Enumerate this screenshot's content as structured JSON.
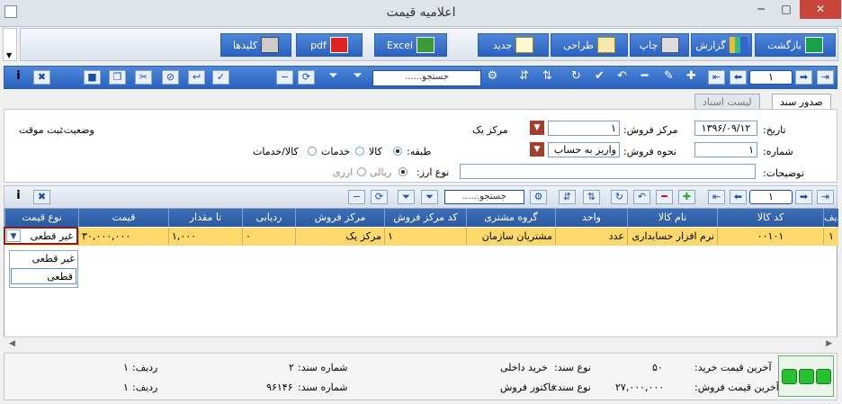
{
  "window": {
    "title": "اعلامیه قیمت"
  },
  "toolbar": {
    "back": "بازگشت",
    "report": "گزارش",
    "print": "چاپ",
    "design": "طراحی",
    "new": "جدید",
    "excel": "Excel",
    "pdf": "pdf",
    "keys": "کلیدها"
  },
  "nav1": {
    "record": "۱",
    "search": "......جستجو"
  },
  "nav2": {
    "record": "۱",
    "search": "......جستجو"
  },
  "tabs": [
    "صدور سند",
    "لیست اسناد"
  ],
  "form": {
    "date_label": "تاریخ:",
    "date_value": "۱۳۹۶/۰۹/۱۲",
    "number_label": "شماره:",
    "number_value": "۱",
    "desc_label": "توضیحات:",
    "center_label": "مرکز فروش:",
    "center_value": "۱",
    "center_name": "مرکز یک",
    "method_label": "نحوه فروش:",
    "method_value": "واریز به حساب",
    "status_label": "وضعیت:",
    "status_value": "ثبت موقت",
    "class_label": "طبقه:",
    "class_opt1": "کالا",
    "class_opt2": "خدمات",
    "class_opt3": "کالا/خدمات",
    "currency_label": "نوع ارز:",
    "currency_opt1": "ریالی",
    "currency_opt2": "ارزی"
  },
  "grid": {
    "headers": [
      "ردیف",
      "کد کالا",
      "نام کالا",
      "واحد",
      "گروه مشتری",
      "کد مرکز فروش",
      "مرکز فروش",
      "ردیابی",
      "تا مقدار",
      "قیمت",
      "نوع قیمت"
    ],
    "row": [
      "۱",
      "۰۰۱۰۱",
      "نرم افزار حسابداری",
      "عدد",
      "مشتریان سازمان",
      "۱",
      "مرکز یک",
      "۰",
      "۱,۰۰۰",
      "۳۰,۰۰۰,۰۰۰",
      "غیر قطعی"
    ]
  },
  "dropdown": {
    "options": [
      "غیر قطعی",
      "قطعی"
    ]
  },
  "footer": {
    "last_buy_label": "آخرین قیمت خرید:",
    "last_buy_value": "۵۰",
    "last_sell_label": "آخرین قیمت فروش:",
    "last_sell_value": "۲۷,۰۰۰,۰۰۰",
    "doc_type_label": "نوع سند:",
    "doc_type1": "خرید داخلی",
    "doc_type2": "فاکتور فروش",
    "doc_no_label": "شماره سند:",
    "doc_no1": "۲",
    "doc_no2": "۹۶۱۴۶",
    "row_label": "ردیف:",
    "row1": "۱",
    "row2": "۱"
  }
}
